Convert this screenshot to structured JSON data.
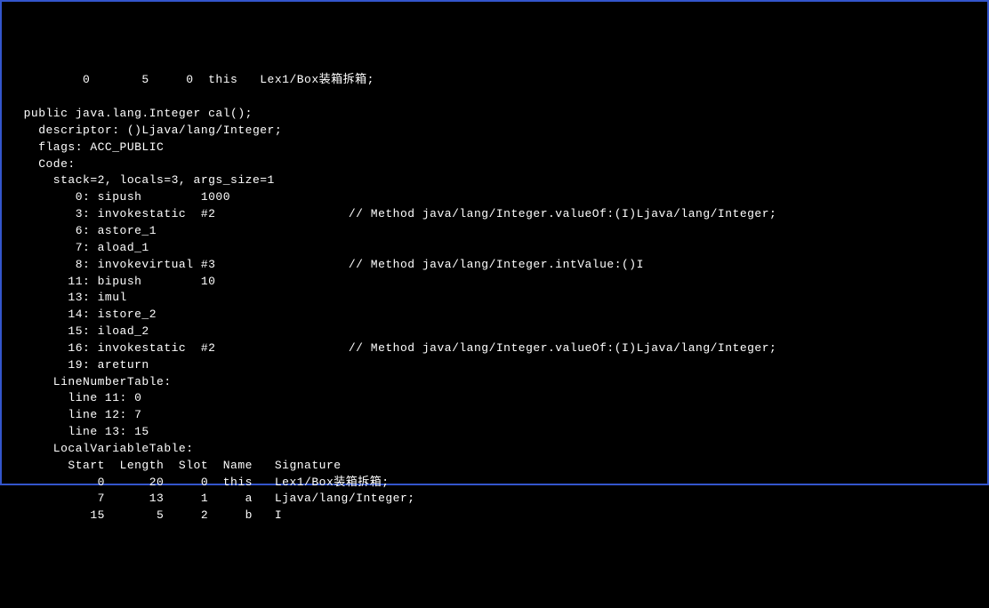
{
  "lines": [
    "          0       5     0  this   Lex1/Box装箱拆箱;",
    "",
    "  public java.lang.Integer cal();",
    "    descriptor: ()Ljava/lang/Integer;",
    "    flags: ACC_PUBLIC",
    "    Code:",
    "      stack=2, locals=3, args_size=1",
    "         0: sipush        1000",
    "         3: invokestatic  #2                  // Method java/lang/Integer.valueOf:(I)Ljava/lang/Integer;",
    "         6: astore_1",
    "         7: aload_1",
    "         8: invokevirtual #3                  // Method java/lang/Integer.intValue:()I",
    "        11: bipush        10",
    "        13: imul",
    "        14: istore_2",
    "        15: iload_2",
    "        16: invokestatic  #2                  // Method java/lang/Integer.valueOf:(I)Ljava/lang/Integer;",
    "        19: areturn",
    "      LineNumberTable:",
    "        line 11: 0",
    "        line 12: 7",
    "        line 13: 15",
    "      LocalVariableTable:",
    "        Start  Length  Slot  Name   Signature",
    "            0      20     0  this   Lex1/Box装箱拆箱;",
    "            7      13     1     a   Ljava/lang/Integer;",
    "           15       5     2     b   I"
  ]
}
